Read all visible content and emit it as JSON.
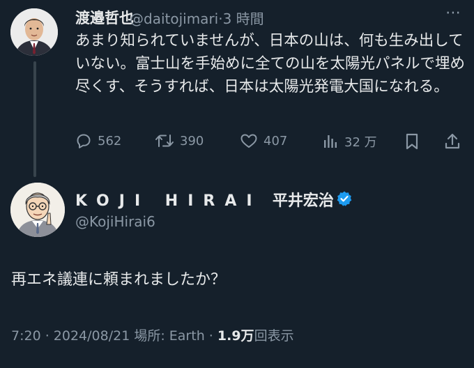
{
  "tweet": {
    "author_name": "渡邉哲也",
    "author_handle": "@daitojimari",
    "separator": "·",
    "time_ago": "3 時間",
    "text": "あまり知られていませんが、日本の山は、何も生み出していない。富士山を手始めに全ての山を太陽光パネルで埋め尽くす、そうすれば、日本は太陽光発電大国になれる。",
    "more_label": "⋯",
    "stats": {
      "replies": "562",
      "retweets": "390",
      "likes": "407",
      "views": "32 万"
    }
  },
  "reply": {
    "author_name_roman": "KOJI HIRAI",
    "author_name_kanji": "平井宏治",
    "author_handle": "@KojiHirai6",
    "text": "再エネ議連に頼まれましたか？",
    "timestamp": "7:20 · 2024/08/21",
    "location": "場所: Earth",
    "dot": "·",
    "view_count": "1.9万",
    "view_label": "回表示"
  },
  "colors": {
    "background": "#15202b",
    "text_primary": "#e7e9ea",
    "text_secondary": "#8b98a5",
    "verified": "#1d9bf0"
  },
  "icons": [
    "reply-icon",
    "retweet-icon",
    "like-icon",
    "views-icon",
    "bookmark-icon",
    "share-icon",
    "verified-icon",
    "more-icon"
  ]
}
